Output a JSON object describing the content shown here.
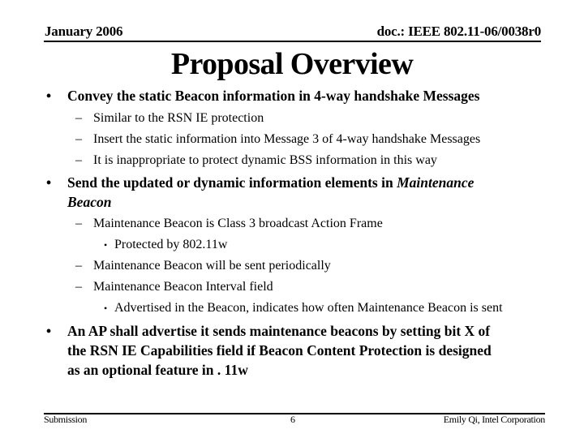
{
  "header": {
    "date": "January 2006",
    "doc_id": "doc.: IEEE 802.11-06/0038r0"
  },
  "title": "Proposal Overview",
  "bullets": [
    {
      "text": "Convey the static Beacon information in 4-way handshake Messages",
      "sub": [
        {
          "text": "Similar to the RSN IE protection"
        },
        {
          "text": "Insert the static information into Message 3  of 4-way handshake Messages"
        },
        {
          "text": "It is inappropriate to protect dynamic BSS information in this way"
        }
      ]
    },
    {
      "text_prefix": "Send the updated or dynamic information elements in ",
      "text_emphasis_line1": "Maintenance",
      "text_emphasis_line2": "Beacon",
      "sub": [
        {
          "text": "Maintenance Beacon is Class 3  broadcast Action Frame",
          "sub": [
            {
              "text": "Protected by 802.11w"
            }
          ]
        },
        {
          "text": "Maintenance Beacon will be sent periodically"
        },
        {
          "text": "Maintenance Beacon Interval  field",
          "sub": [
            {
              "text": "Advertised in the Beacon, indicates how often Maintenance Beacon is  sent"
            }
          ]
        }
      ]
    },
    {
      "lines": [
        "An AP shall advertise it sends maintenance beacons by setting bit X of",
        "the RSN IE Capabilities field if Beacon Content Protection is designed",
        "as an optional feature in . 11w"
      ]
    }
  ],
  "markers": {
    "level1": "•",
    "level2": "–",
    "level3": "•"
  },
  "footer": {
    "left": "Submission",
    "page": "6",
    "right": "Emily Qi, Intel Corporation"
  }
}
